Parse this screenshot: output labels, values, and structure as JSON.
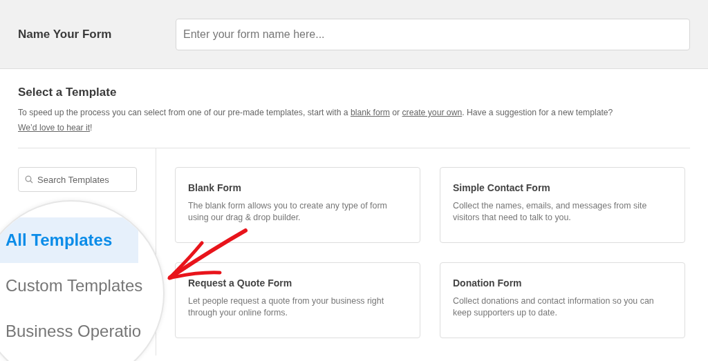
{
  "name_form": {
    "label": "Name Your Form",
    "placeholder": "Enter your form name here..."
  },
  "template_section": {
    "title": "Select a Template",
    "description": [
      {
        "text": "To speed up the process you can select from one of our pre-made templates, start with a ",
        "kind": "text"
      },
      {
        "text": "blank form",
        "kind": "link"
      },
      {
        "text": " or ",
        "kind": "text"
      },
      {
        "text": "create your own",
        "kind": "link"
      },
      {
        "text": ". Have a suggestion for a new template? ",
        "kind": "text"
      },
      {
        "text": "We’d love to hear it",
        "kind": "link"
      },
      {
        "text": "!",
        "kind": "text"
      }
    ]
  },
  "search": {
    "placeholder": "Search Templates"
  },
  "categories": [
    {
      "label": "All Templates",
      "selected": true
    },
    {
      "label": "Custom Templates",
      "selected": false
    },
    {
      "label": "Business Operatio",
      "selected": false
    }
  ],
  "templates": [
    {
      "title": "Blank Form",
      "description": "The blank form allows you to create any type of form using our drag & drop builder."
    },
    {
      "title": "Simple Contact Form",
      "description": "Collect the names, emails, and messages from site visitors that need to talk to you."
    },
    {
      "title": "Request a Quote Form",
      "description": "Let people request a quote from your business right through your online forms."
    },
    {
      "title": "Donation Form",
      "description": "Collect donations and contact information so you can keep supporters up to date."
    }
  ]
}
